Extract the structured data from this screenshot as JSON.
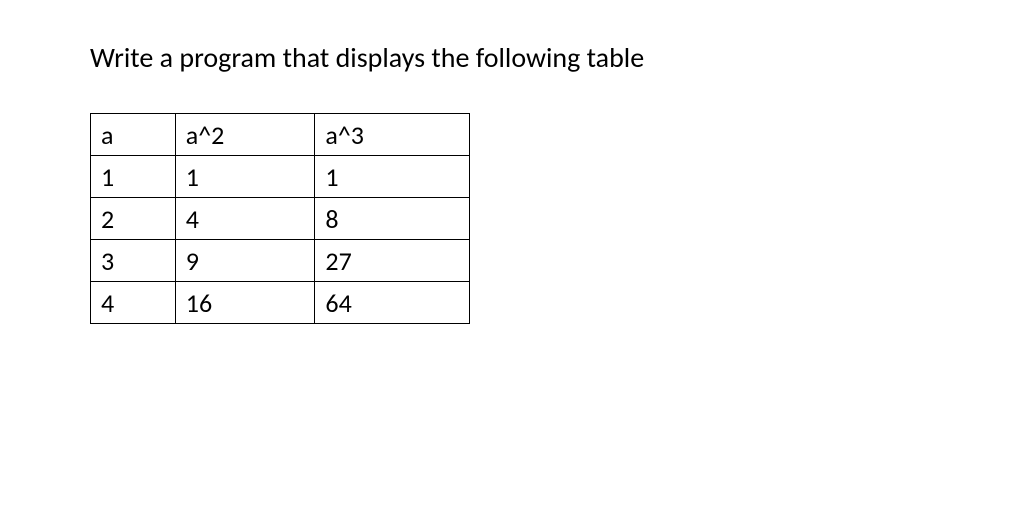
{
  "heading": "Write a program that displays the following table",
  "chart_data": {
    "type": "table",
    "headers": [
      "a",
      "a^2",
      "a^3"
    ],
    "rows": [
      [
        "1",
        "1",
        "1"
      ],
      [
        "2",
        "4",
        "8"
      ],
      [
        "3",
        "9",
        "27"
      ],
      [
        "4",
        "16",
        "64"
      ]
    ]
  }
}
